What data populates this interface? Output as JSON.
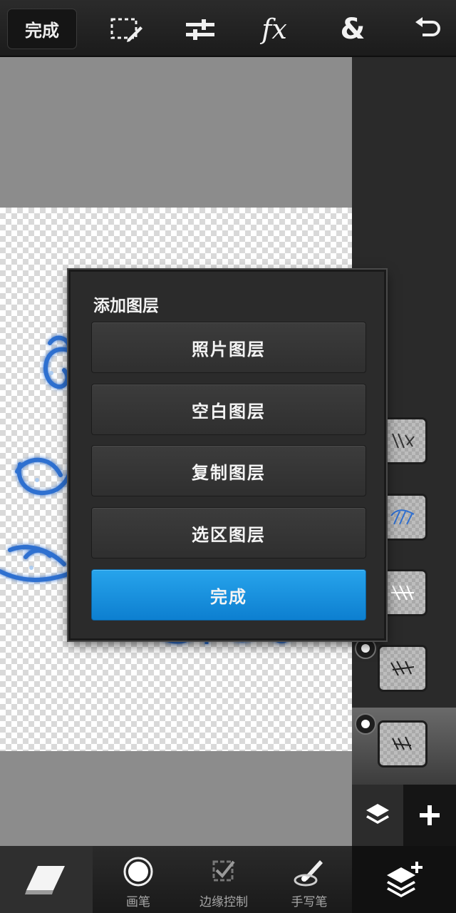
{
  "toolbar": {
    "done_label": "完成",
    "icons": [
      "select-edit-icon",
      "adjust-sliders-icon",
      "fx-icon",
      "ampersand-icon",
      "undo-icon"
    ],
    "fx_text": "fx",
    "amp_text": "&"
  },
  "dialog": {
    "title": "添加图层",
    "buttons": [
      {
        "label": "照片图层"
      },
      {
        "label": "空白图层"
      },
      {
        "label": "复制图层"
      },
      {
        "label": "选区图层"
      }
    ],
    "confirm_label": "完成"
  },
  "bottom_tools": [
    {
      "icon": "eraser-icon",
      "label": ""
    },
    {
      "icon": "brush-circle-icon",
      "label": "画笔"
    },
    {
      "icon": "edge-control-icon",
      "label": "边缘控制"
    },
    {
      "icon": "handwriting-pen-icon",
      "label": "手写笔"
    }
  ],
  "layers": {
    "count": 5,
    "active_index": 4,
    "visible_indicators": [
      3,
      4
    ]
  },
  "colors": {
    "accent": "#1a90e0",
    "panel": "#2b2b2b",
    "canvas_bg": "#8a8a8a"
  }
}
